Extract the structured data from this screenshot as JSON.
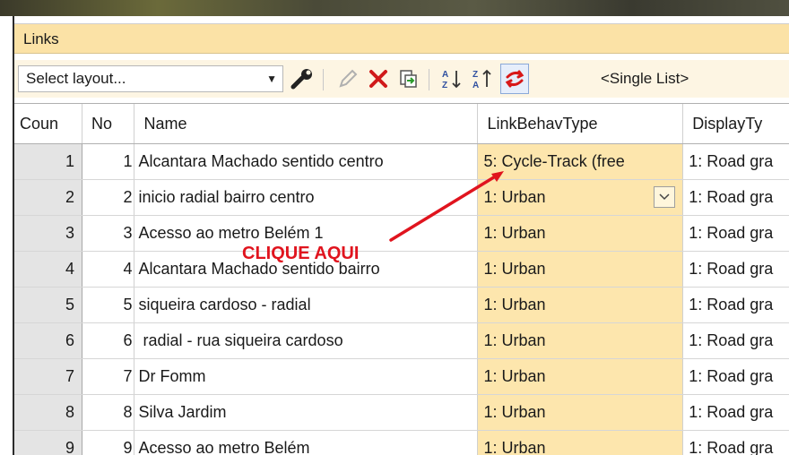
{
  "window": {
    "title": "Links"
  },
  "toolbar": {
    "layout_select": "Select layout...",
    "list_mode": "<Single List>",
    "icons": [
      "wrench-icon",
      "pencil-icon",
      "delete-x-icon",
      "export-icon",
      "sort-ascending-icon",
      "sort-descending-icon",
      "sync-arrows-icon"
    ]
  },
  "table": {
    "headers": [
      "Coun",
      "No",
      "Name",
      "LinkBehavType",
      "DisplayTy"
    ],
    "rows": [
      {
        "count": "1",
        "no": "1",
        "name": "Alcantara Machado sentido centro",
        "lbt": "5: Cycle-Track (free",
        "disp": "1: Road gra"
      },
      {
        "count": "2",
        "no": "2",
        "name": "inicio radial bairro centro",
        "lbt": "1: Urban",
        "disp": "1: Road gra"
      },
      {
        "count": "3",
        "no": "3",
        "name": "Acesso ao metro Belém 1",
        "lbt": "1: Urban",
        "disp": "1: Road gra"
      },
      {
        "count": "4",
        "no": "4",
        "name": "Alcantara Machado sentido bairro",
        "lbt": "1: Urban",
        "disp": "1: Road gra"
      },
      {
        "count": "5",
        "no": "5",
        "name": "siqueira cardoso - radial",
        "lbt": "1: Urban",
        "disp": "1: Road gra"
      },
      {
        "count": "6",
        "no": "6",
        "name": " radial - rua siqueira cardoso",
        "lbt": "1: Urban",
        "disp": "1: Road gra"
      },
      {
        "count": "7",
        "no": "7",
        "name": "Dr Fomm",
        "lbt": "1: Urban",
        "disp": "1: Road gra"
      },
      {
        "count": "8",
        "no": "8",
        "name": "Silva Jardim",
        "lbt": "1: Urban",
        "disp": "1: Road gra"
      },
      {
        "count": "9",
        "no": "9",
        "name": "Acesso ao metro Belém",
        "lbt": "1: Urban",
        "disp": "1: Road gra"
      }
    ]
  },
  "annotation": {
    "text": "CLIQUE AQUI",
    "color": "#e0141e"
  },
  "colors": {
    "title_bar": "#fbe2a6",
    "highlight_column": "#fde6ad",
    "count_column": "#e4e4e4"
  }
}
